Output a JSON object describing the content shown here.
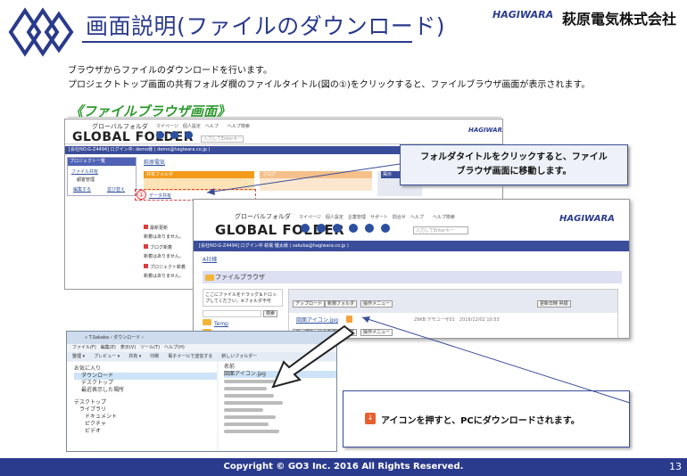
{
  "header": {
    "title": "画面説明(ファイルのダウンロード)",
    "hagiwara_logo": "HAGIWARA",
    "company": "萩原電気株式会社"
  },
  "intro": {
    "line1": "ブラウザからファイルのダウンロードを行います。",
    "line2": "プロジェクトトップ画面の共有フォルダ欄のファイルタイトル(図の①)をクリックすると、ファイルブラウザ画面が表示されます。"
  },
  "section_heading": "《ファイルブラウザ画面》",
  "screen1": {
    "brand_small": "グローバルフォルダ",
    "brand": "GLOBAL FOLDER",
    "nav": "マイページ　個人設定　ヘルプ　　ヘルプ検索",
    "search_placeholder": "入力してEnterキー",
    "hagiwara": "HAGIWARA",
    "bar": "[会社NO:G-Z4494] ログイン中: demo様 ( demo@hagiwara.co.jp )",
    "side_header": "プロジェクト一覧",
    "side_item1": "ファイル共有",
    "side_item2": "顧客管理",
    "side_edit": "編集する",
    "side_order": "並び替え",
    "main_link": "萩原電気",
    "orange_header": "共有フォルダ",
    "peach_header": "ブログ",
    "blue_header": "掲示",
    "marker": "①",
    "file_link": "データ共有",
    "notices": [
      "最新更新",
      "ブログ新着",
      "プロジェクト新着"
    ],
    "notice_text": "新着はありません。"
  },
  "callout1": {
    "line1": "フォルダタイトルをクリックすると、ファイル",
    "line2": "ブラウザ画面に移動します。"
  },
  "screen2": {
    "brand_small": "グローバルフォルダ",
    "brand": "GLOBAL FOLDER",
    "nav": "マイページ　個人設定　企業管理　サポート　問合せ　ヘルプ　　ヘルプ検索",
    "search_placeholder": "入力してEnterキー",
    "hagiwara": "HAGIWARA",
    "bar": "[会社NO:G-Z4494] ログイン中 萩電 優太様 ( sakuba@hagiwara.co.jp )",
    "crumb": "A社様",
    "file_browser": "ファイルブラウザ",
    "drop_text": "ここにファイルをドラッグ＆ドロップしてください。※フォルダ不可",
    "search_btn": "検索",
    "upload_btn": "アップロード",
    "new_folder_btn": "新規フォルダ",
    "ops_btn": "操作メニュー",
    "sort_select": "更新日時 昇順",
    "file_name": "図面アイコン.jpg",
    "file_meta": "29KB デモユーザ01　2016/12/02 10:53",
    "folders": [
      "Temp",
      "ログ"
    ]
  },
  "explorer": {
    "path": "« T.Sakaba › ダウンロード ›",
    "menu": "ファイル(F)　編集(E)　表示(V)　ツール(T)　ヘルプ(H)",
    "toolbar": "整理 ▾　　プレビュー ▾　　共有 ▾　　印刷　　電子メールで送信する　　新しいフォルダー",
    "nav_items": [
      "お気に入り",
      "ダウンロード",
      "デスクトップ",
      "最近表示した場所",
      "デスクトップ",
      "ライブラリ",
      "ドキュメント",
      "ピクチャ",
      "ビデオ"
    ],
    "list_header": "名前",
    "file_selected": "図面アイコン.jpg"
  },
  "callout2": {
    "text": "アイコンを押すと、PCにダウンロードされます。"
  },
  "footer": {
    "copyright": "Copyright © GO3 Inc. 2016  All Rights Reserved.",
    "page": "13"
  }
}
